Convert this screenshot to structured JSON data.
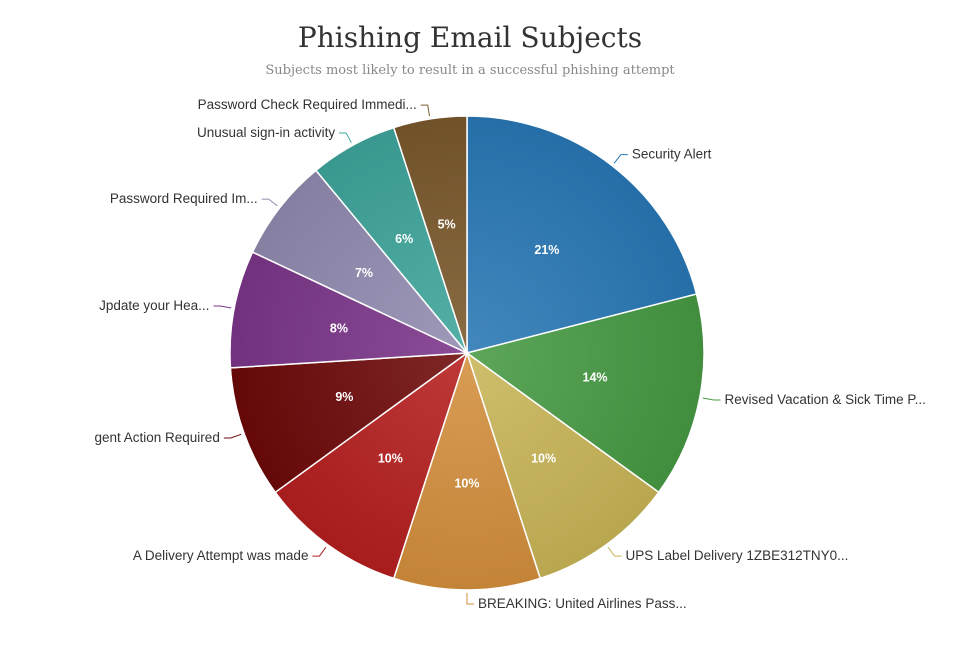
{
  "chart_data": {
    "type": "pie",
    "title": "Phishing Email Subjects",
    "subtitle": "Subjects most likely to result in a successful phishing attempt",
    "slices": [
      {
        "label": "Security Alert",
        "value": 21,
        "value_label": "21%",
        "color": "#2878b5"
      },
      {
        "label": "Revised Vacation & Sick Time P...",
        "value": 14,
        "value_label": "14%",
        "color": "#479a43"
      },
      {
        "label": "UPS Label Delivery 1ZBE312TNY0...",
        "value": 10,
        "value_label": "10%",
        "color": "#c9b557"
      },
      {
        "label": "BREAKING: United Airlines Pass...",
        "value": 10,
        "value_label": "10%",
        "color": "#d48f3d"
      },
      {
        "label": "A Delivery Attempt was made",
        "value": 10,
        "value_label": "10%",
        "color": "#b61e1e"
      },
      {
        "label": "gent Action Required",
        "value": 9,
        "value_label": "9%",
        "color": "#6e0909"
      },
      {
        "label": "Jpdate your Hea...",
        "value": 8,
        "value_label": "8%",
        "color": "#7b3589"
      },
      {
        "label": "Password Required Im...",
        "value": 7,
        "value_label": "7%",
        "color": "#918ab0"
      },
      {
        "label": "Unusual sign-in activity",
        "value": 6,
        "value_label": "6%",
        "color": "#3ea59b"
      },
      {
        "label": "Password Check Required Immedi...",
        "value": 5,
        "value_label": "5%",
        "color": "#7a582b"
      }
    ]
  }
}
